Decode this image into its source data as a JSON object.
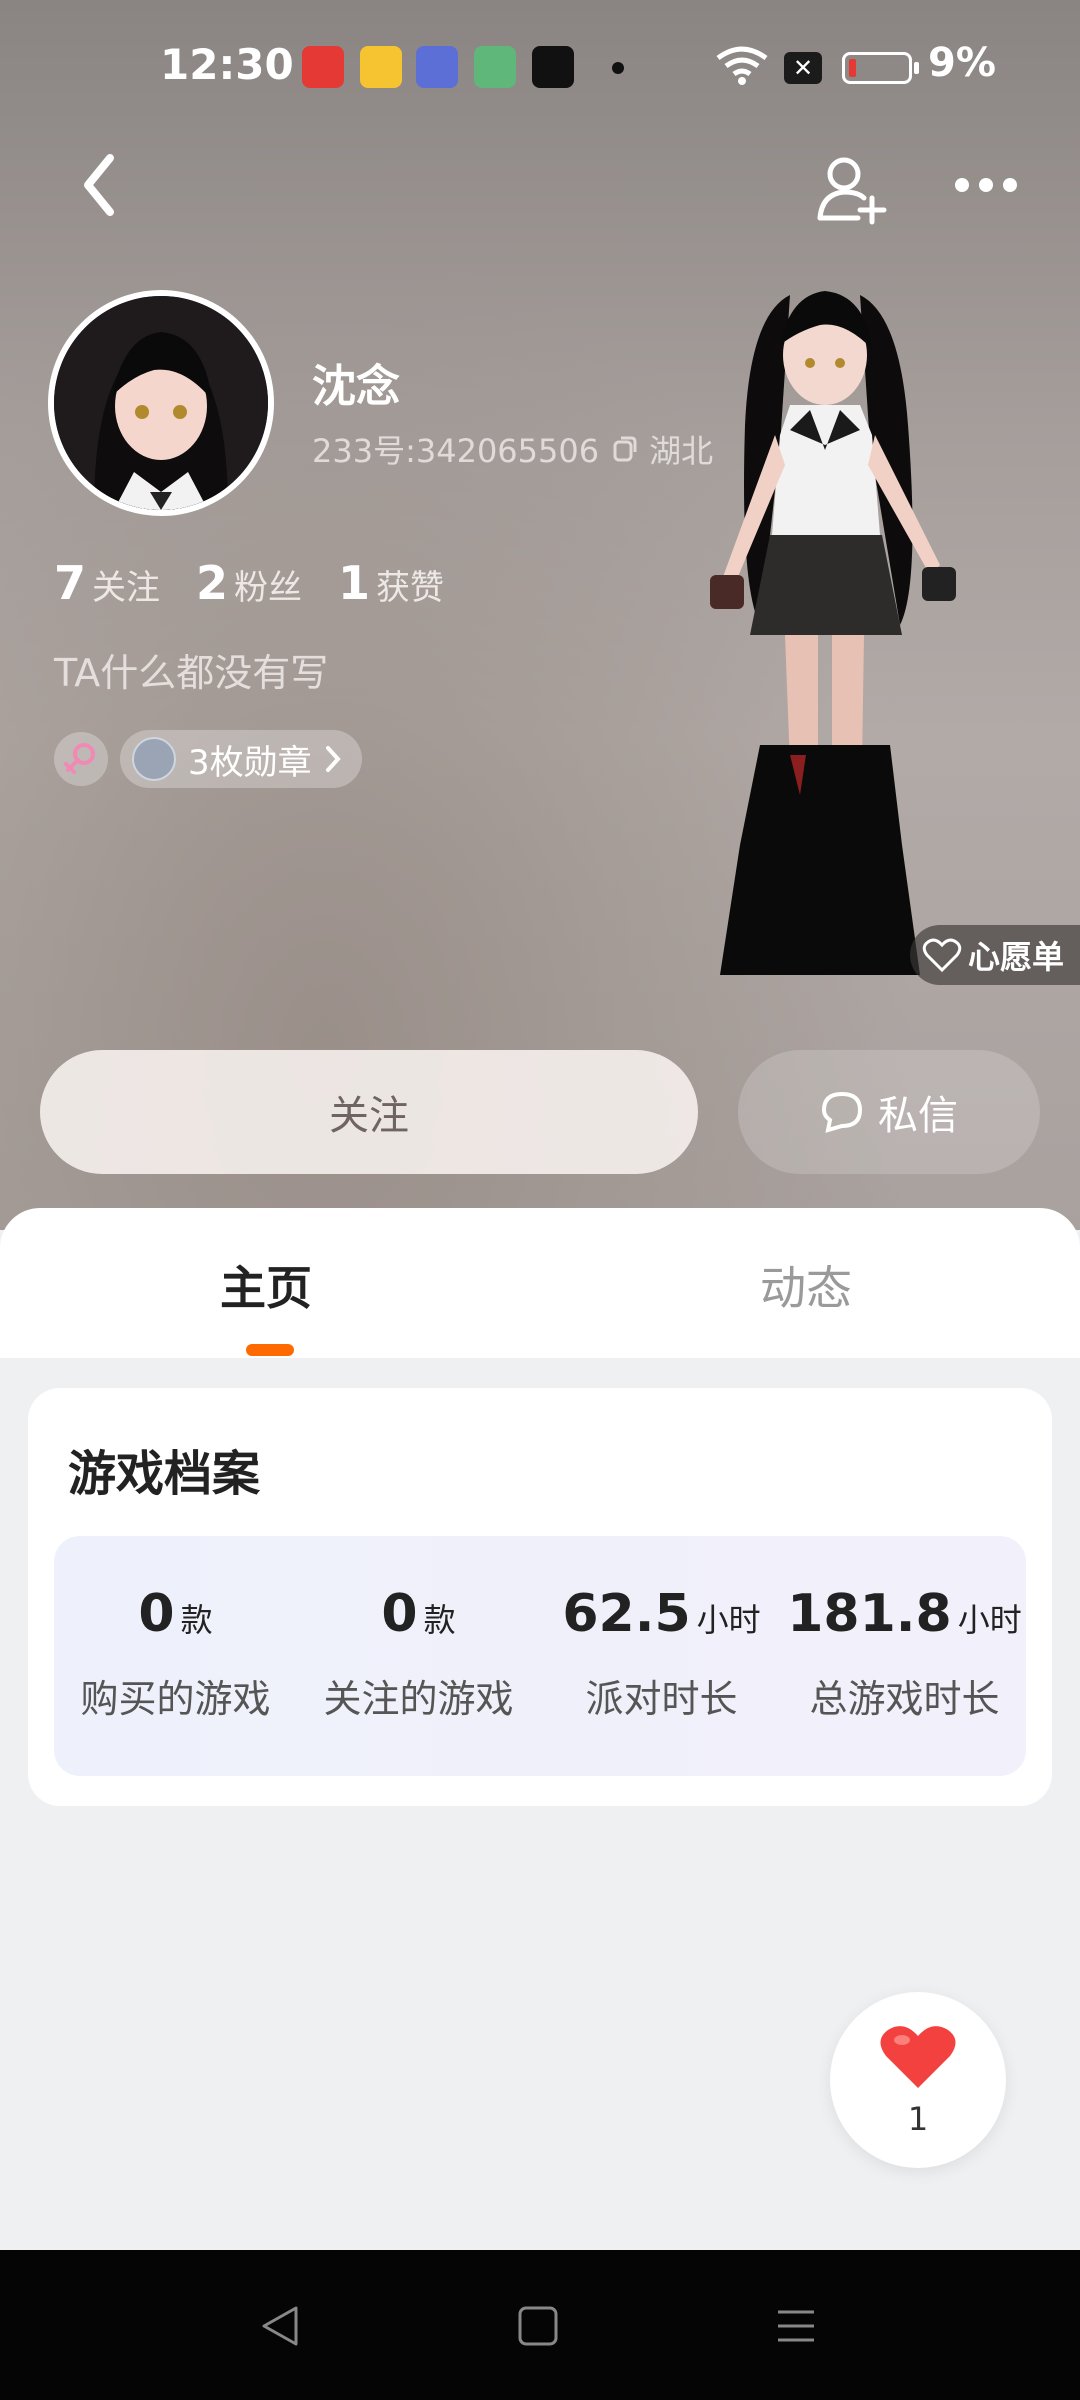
{
  "status_bar": {
    "time": "12:30",
    "battery": "9%",
    "battery_color": "#e53935"
  },
  "nav": {
    "back_icon": "chevron-left-icon",
    "add_friend_icon": "add-user-icon",
    "more_icon": "more-dots-icon"
  },
  "profile": {
    "name": "沈念",
    "uid": "233号:342065506",
    "location": "湖北",
    "stats": [
      {
        "num": "7",
        "label": "关注"
      },
      {
        "num": "2",
        "label": "粉丝"
      },
      {
        "num": "1",
        "label": "获赞"
      }
    ],
    "bio": "TA什么都没有写",
    "medal_label": "3枚勋章",
    "wishlist_label": "心愿单"
  },
  "actions": {
    "follow_label": "关注",
    "message_label": "私信"
  },
  "tabs": {
    "home": "主页",
    "feed": "动态",
    "active_color": "#ff6a00"
  },
  "game_card": {
    "title": "游戏档案",
    "items": [
      {
        "value": "0",
        "unit": "款",
        "label": "购买的游戏"
      },
      {
        "value": "0",
        "unit": "款",
        "label": "关注的游戏"
      },
      {
        "value": "62.5",
        "unit": "小时",
        "label": "派对时长"
      },
      {
        "value": "181.8",
        "unit": "小时",
        "label": "总游戏时长"
      }
    ]
  },
  "like": {
    "count": "1",
    "color": "#f2413f"
  }
}
